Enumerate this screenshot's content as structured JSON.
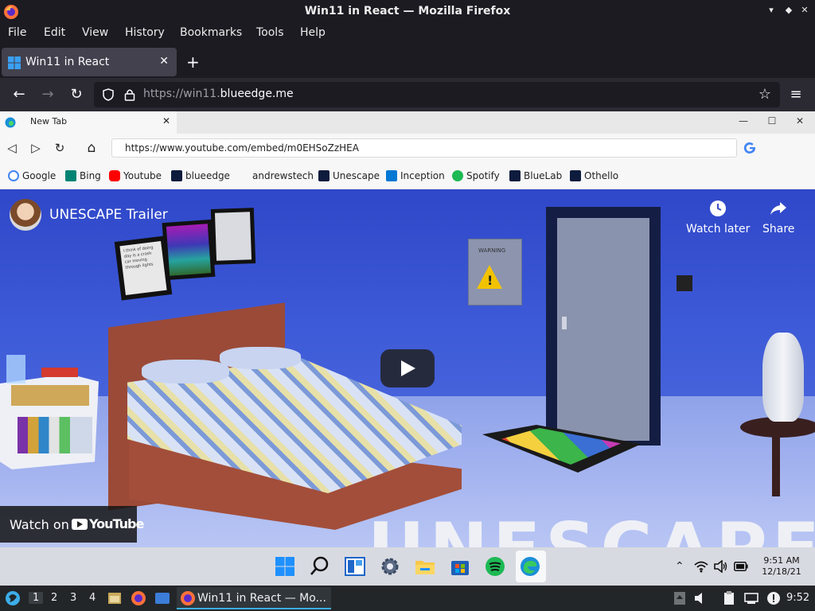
{
  "window": {
    "title": "Win11 in React — Mozilla Firefox",
    "minimize": "▾",
    "maximize": "◆",
    "close": "✕"
  },
  "menu": [
    "File",
    "Edit",
    "View",
    "History",
    "Bookmarks",
    "Tools",
    "Help"
  ],
  "tab": {
    "label": "Win11 in React",
    "close": "✕",
    "new_tab": "+"
  },
  "nav": {
    "url_prefix": "https://win11.",
    "url_host": "blueedge.me"
  },
  "edge": {
    "tab_label": "New Tab",
    "tab_close": "✕",
    "min": "—",
    "max": "☐",
    "close": "✕",
    "address": "https://www.youtube.com/embed/m0EHSoZzHEA",
    "bookmarks": [
      {
        "label": "Google",
        "color": "#4285f4"
      },
      {
        "label": "Bing",
        "color": "#008373"
      },
      {
        "label": "Youtube",
        "color": "#ff0000"
      },
      {
        "label": "blueedge",
        "color": "#0d1b3d"
      },
      {
        "label": "andrewstech",
        "color": ""
      },
      {
        "label": "Unescape",
        "color": "#0d1b3d"
      },
      {
        "label": "Inception",
        "color": "#0078d4"
      },
      {
        "label": "Spotify",
        "color": "#1db954"
      },
      {
        "label": "BlueLab",
        "color": "#0d1b3d"
      },
      {
        "label": "Othello",
        "color": "#0d1b3d"
      }
    ]
  },
  "video": {
    "title": "UNESCAPE Trailer",
    "watch_later": "Watch later",
    "share": "Share",
    "watch_on": "Watch on",
    "youtube": "YouTube",
    "overlay_text": "UNESCAPE",
    "panel_warning": "WARNING",
    "frame_text": "I think of doing day is a crash car moving through lights"
  },
  "win11_taskbar": {
    "clock_time": "9:51 AM",
    "clock_date": "12/18/21",
    "icons": [
      "windows-start-icon",
      "search-icon",
      "widgets-icon",
      "settings-icon",
      "file-explorer-icon",
      "store-icon",
      "spotify-icon",
      "edge-icon"
    ]
  },
  "host_taskbar": {
    "workspaces": [
      "1",
      "2",
      "3",
      "4"
    ],
    "task_label": "Win11 in React — Mo...",
    "time": "9:52"
  },
  "colors": {
    "firefox_bg": "#1c1b22",
    "accent": "#3daee9"
  }
}
